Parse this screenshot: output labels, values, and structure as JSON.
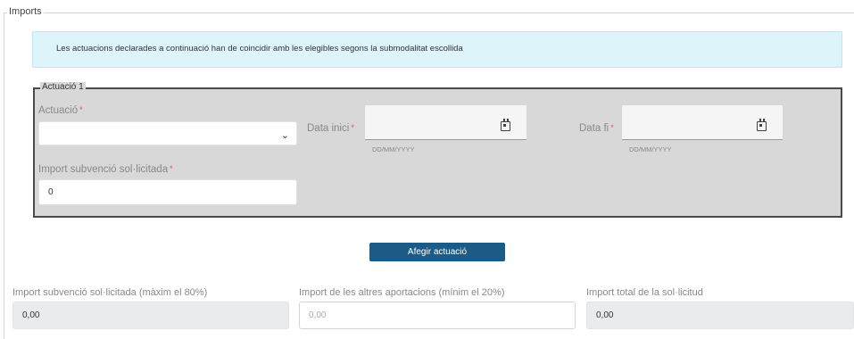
{
  "section": {
    "legend": "Imports"
  },
  "info": {
    "text": "Les actuacions declarades a continuació han de coincidir amb les elegibles segons la submodalitat escollida"
  },
  "actuacio": {
    "legend": "Actuació 1",
    "actuacio_label": "Actuació",
    "actuacio_value": "",
    "data_inici_label": "Data inici",
    "data_inici_hint": "DD/MM/YYYY",
    "data_fi_label": "Data fi",
    "data_fi_hint": "DD/MM/YYYY",
    "import_label": "Import subvenció sol·licitada",
    "import_value": "0",
    "required_mark": "*"
  },
  "add_button": {
    "label": "Afegir actuació"
  },
  "totals": {
    "subvencio_label": "Import subvenció sol·licitada (màxim el 80%)",
    "subvencio_value": "0,00",
    "altres_label": "Import de les altres aportacions (mínim el 20%)",
    "altres_placeholder": "0,00",
    "total_label": "Import total de la sol·licitud",
    "total_value": "0,00"
  },
  "icons": {
    "chevron": "chevron-down-icon",
    "calendar": "calendar-icon"
  },
  "colors": {
    "button": "#1d5b87",
    "info_bg": "#ddf4fb",
    "required": "#d9534f",
    "panel_bg": "#d8d8d8"
  }
}
